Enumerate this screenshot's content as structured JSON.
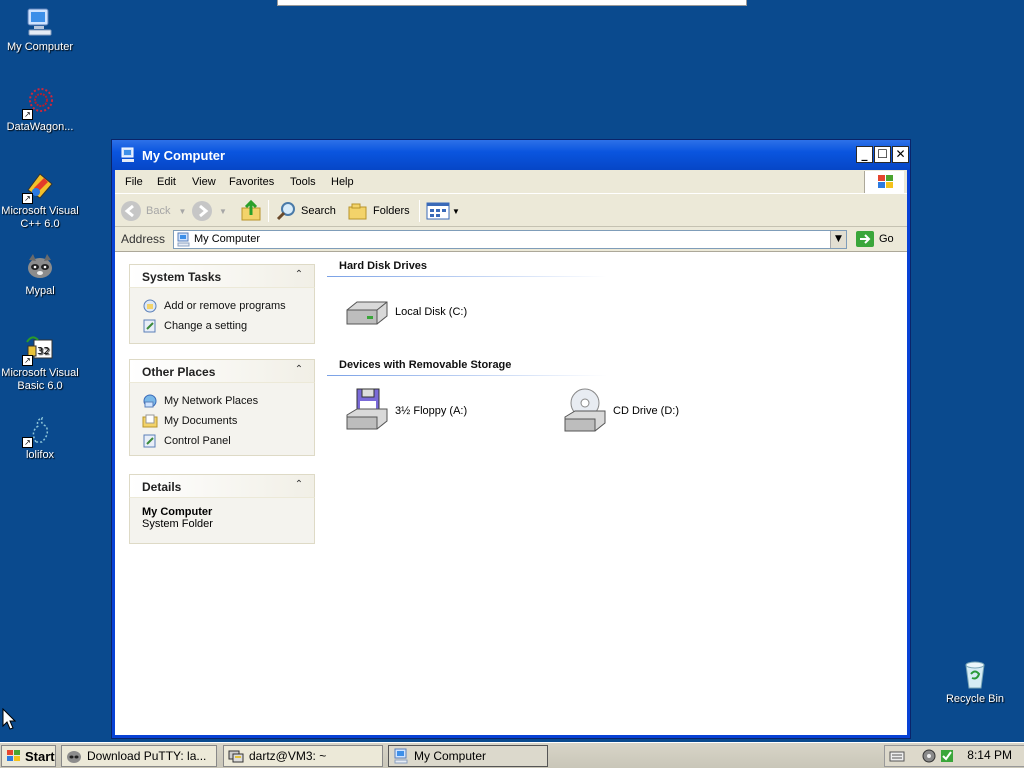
{
  "desktop": {
    "icons": [
      {
        "label": "My Computer"
      },
      {
        "label": "DataWagon..."
      },
      {
        "label": "Microsoft Visual C++ 6.0"
      },
      {
        "label": "Mypal"
      },
      {
        "label": "Microsoft Visual Basic 6.0"
      },
      {
        "label": "lolifox"
      },
      {
        "label": "Recycle Bin"
      }
    ]
  },
  "window": {
    "title": "My Computer",
    "controls": {
      "minimize": "_",
      "maximize": "☐",
      "close": "✕"
    },
    "menu": [
      "File",
      "Edit",
      "View",
      "Favorites",
      "Tools",
      "Help"
    ],
    "toolbar": {
      "back": "Back",
      "search": "Search",
      "folders": "Folders"
    },
    "address": {
      "label": "Address",
      "value": "My Computer",
      "go": "Go"
    },
    "panels": {
      "system_tasks": {
        "title": "System Tasks",
        "links": [
          "Add or remove programs",
          "Change a setting"
        ]
      },
      "other_places": {
        "title": "Other Places",
        "links": [
          "My Network Places",
          "My Documents",
          "Control Panel"
        ]
      },
      "details": {
        "title": "Details",
        "name": "My Computer",
        "type": "System Folder"
      }
    },
    "groups": {
      "hard_disks": {
        "title": "Hard Disk Drives",
        "items": [
          "Local Disk (C:)"
        ]
      },
      "removable": {
        "title": "Devices with Removable Storage",
        "items": [
          "3½ Floppy (A:)",
          "CD Drive (D:)"
        ]
      }
    }
  },
  "taskbar": {
    "start": "Start",
    "tasks": [
      {
        "label": "Download PuTTY: la..."
      },
      {
        "label": "dartz@VM3: ~"
      },
      {
        "label": "My Computer",
        "active": true
      }
    ],
    "clock": "8:14 PM"
  },
  "colors": {
    "desktop": "#0a4a8e",
    "titlebar": "#0a55df",
    "window_bg": "#ece9d8"
  }
}
